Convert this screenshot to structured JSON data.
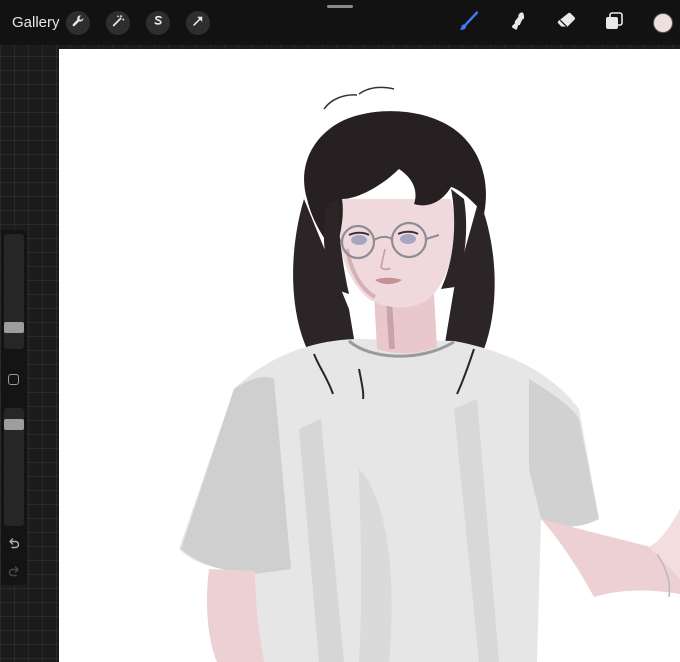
{
  "toolbar": {
    "gallery_label": "Gallery",
    "left_tools": [
      {
        "name": "actions",
        "icon": "wrench-icon"
      },
      {
        "name": "adjustments",
        "icon": "magic-wand-icon"
      },
      {
        "name": "selection",
        "icon": "selection-s-icon"
      },
      {
        "name": "transform",
        "icon": "transform-arrow-icon"
      }
    ],
    "right_tools": [
      {
        "name": "brush",
        "icon": "brush-icon",
        "active": true
      },
      {
        "name": "smudge",
        "icon": "smudge-icon",
        "active": false
      },
      {
        "name": "eraser",
        "icon": "eraser-icon",
        "active": false
      },
      {
        "name": "layers",
        "icon": "layers-icon",
        "active": false
      }
    ],
    "current_color": "#f1dede"
  },
  "sidebar": {
    "brush_size_level": 0.15,
    "opacity_level": 0.9,
    "modify_icon": "square-icon",
    "undo_icon": "undo-icon",
    "redo_icon": "redo-icon"
  },
  "colors": {
    "accent": "#3d7bf0",
    "toolbar_bg": "#121212",
    "canvas_bg": "#ffffff"
  },
  "canvas": {
    "subject": "illustration-person-glasses-white-tshirt"
  }
}
